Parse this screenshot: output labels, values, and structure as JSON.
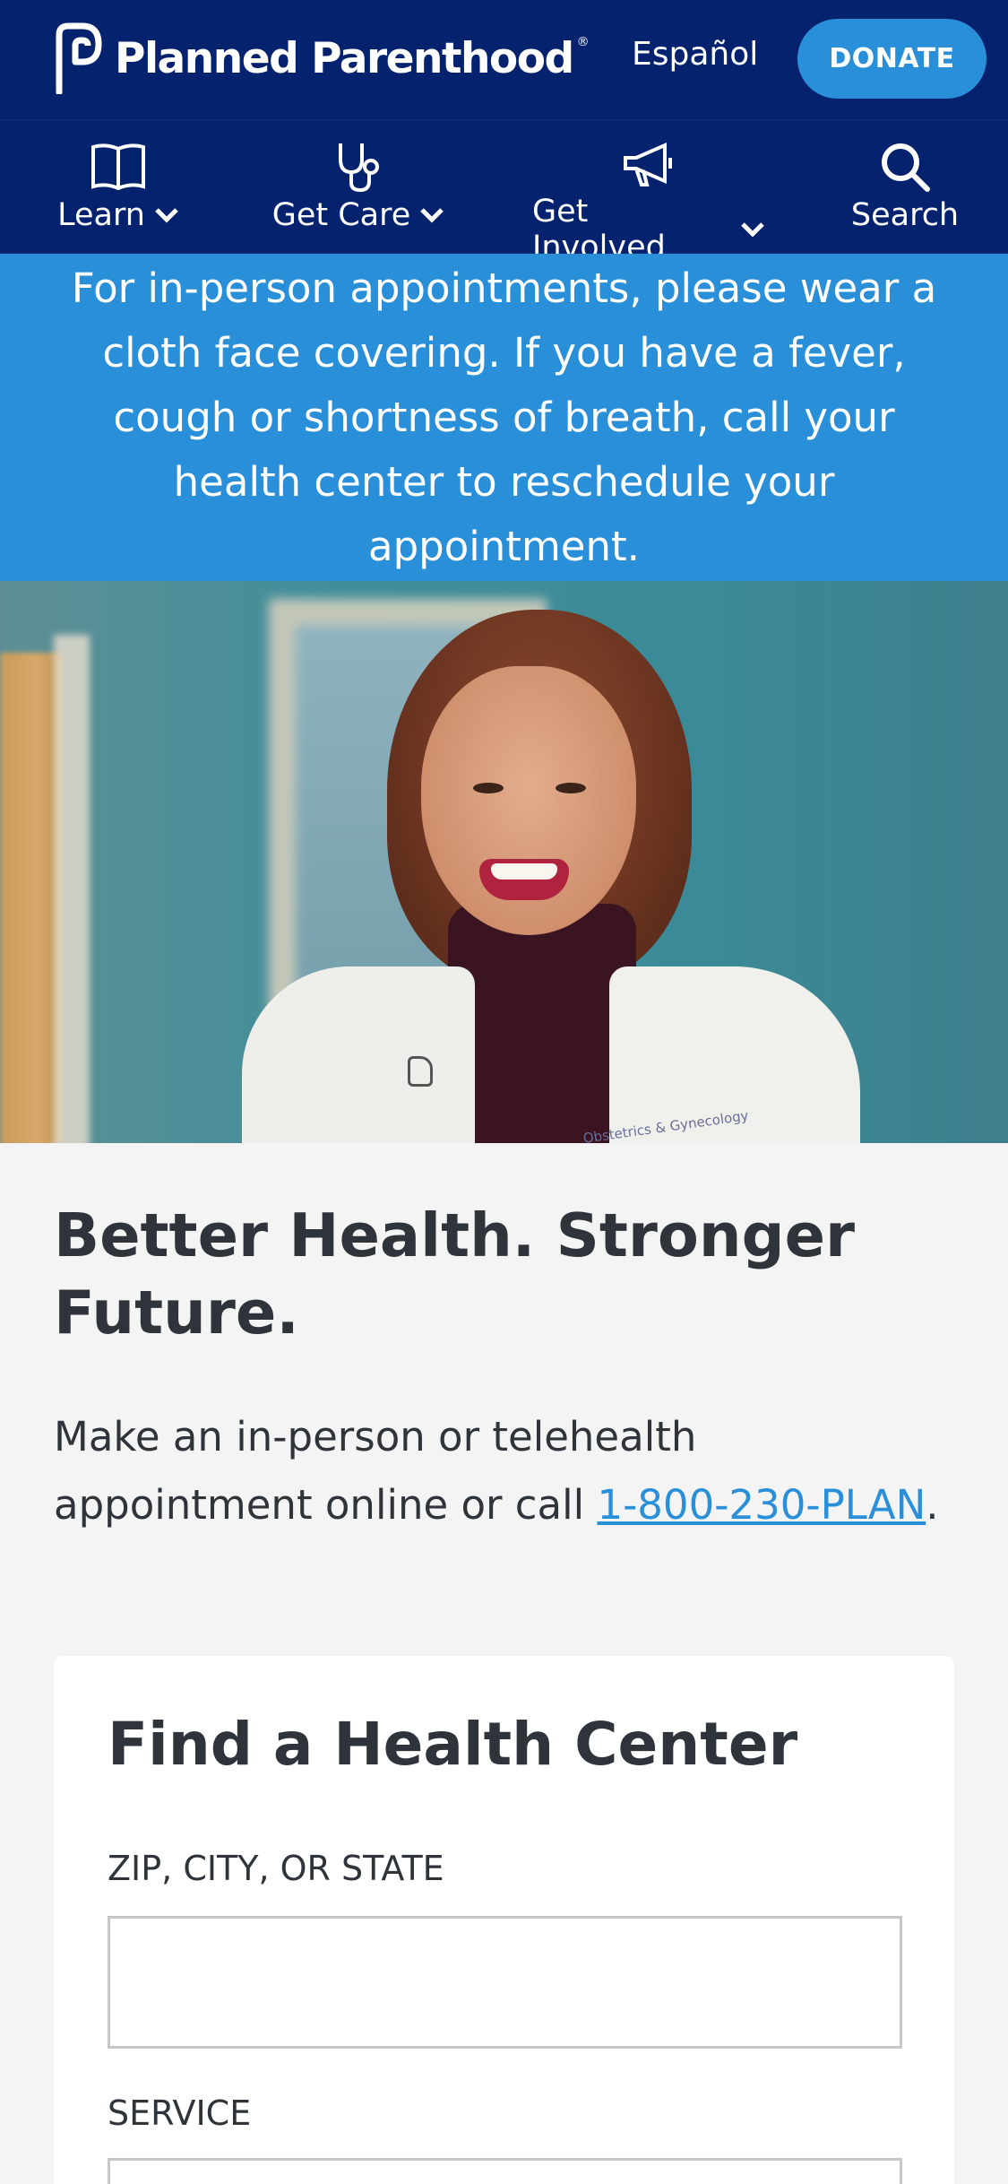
{
  "header": {
    "logo_text": "Planned Parenthood",
    "logo_registered": "®",
    "language_link": "Español",
    "donate_label": "DONATE"
  },
  "nav": {
    "items": [
      {
        "label": "Learn",
        "icon": "book-icon",
        "dropdown": true
      },
      {
        "label": "Get Care",
        "icon": "stethoscope-icon",
        "dropdown": true
      },
      {
        "label": "Get Involved",
        "icon": "megaphone-icon",
        "dropdown": true
      },
      {
        "label": "Search",
        "icon": "search-icon",
        "dropdown": false
      }
    ]
  },
  "alert": {
    "text": "For in-person appointments, please wear a cloth face covering. If you have a fever, cough or shortness of breath, call your health center to reschedule your appointment."
  },
  "hero": {
    "coat_text": "Obstetrics & Gynecology"
  },
  "main": {
    "headline": "Better Health. Stronger Future.",
    "intro_text": "Make an in-person or telehealth appointment online or call",
    "phone_link": "1-800-230-PLAN",
    "intro_end": "."
  },
  "find_center": {
    "title": "Find a Health Center",
    "zip_label": "ZIP, CITY, OR STATE",
    "zip_value": "",
    "service_label": "SERVICE"
  },
  "colors": {
    "navy": "#04226d",
    "accent_blue": "#2a8fd9",
    "text_dark": "#2f343b",
    "background": "#f4f4f4"
  }
}
